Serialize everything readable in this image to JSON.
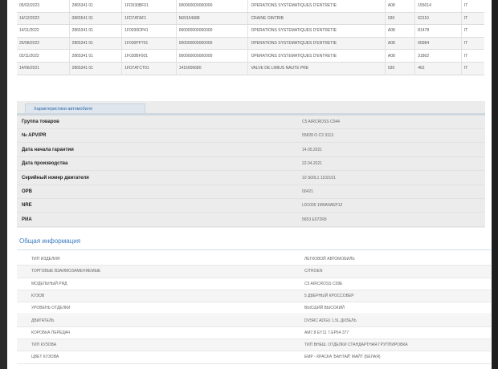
{
  "history": [
    [
      "05/02/2023",
      "2865341 01",
      "1FD030BF01",
      "000000000000000",
      "OPERATIONS SYSTEMATIQUES D'ENTRETIE",
      "A08",
      "155014",
      "IT"
    ],
    [
      "14/12/2022",
      "0865541 01",
      "1FD7ATAF1",
      "N09154688",
      "CRAINE OINTRIB",
      "030",
      "62110",
      "IT"
    ],
    [
      "14/11/2022",
      "2865341 01",
      "1F0030DP41",
      "000000000000000",
      "OPERATIONS SYSTEMATIQUES D'ENTRETIE",
      "A08",
      "81478",
      "IT"
    ],
    [
      "26/08/2022",
      "2865341 01",
      "1F030PP701",
      "000000000000000",
      "OPERATIONS SYSTEMATIQUES D'ENTRETIE",
      "A08",
      "66984",
      "IT"
    ],
    [
      "02/11/2022",
      "2865341 01",
      "1F030BF001",
      "000000000000000",
      "OPERATIONS SYSTEMATIQUES D'ENTRETIE",
      "A08",
      "31802",
      "IT"
    ],
    [
      "14/06/2021",
      "2865341 01",
      "1FD7ATCT01",
      "1415006680",
      "VALVE DE LIMIUS NAUTE PRE",
      "030",
      "462",
      "IT"
    ]
  ],
  "characteristics": {
    "tab_label": "Характеристики автомобиля",
    "rows": [
      {
        "label": "Группа товаров",
        "value": "C5 AIRCROSS C044"
      },
      {
        "label": "№ APV/PR",
        "value": "55828 O.C3 3113"
      },
      {
        "label": "Дата начала гарантии",
        "value": "14.05.2021"
      },
      {
        "label": "Дата производства",
        "value": "22.04.2021"
      },
      {
        "label": "Серийный номер двигателя",
        "value": "10 S00L1 1102101"
      },
      {
        "label": "OPB",
        "value": "00421"
      },
      {
        "label": "NRE",
        "value": "LD1005 1M9A9AEP12"
      },
      {
        "label": "PИA",
        "value": "5653 E072R9"
      }
    ]
  },
  "general": {
    "title": "Общая информация",
    "rows": [
      {
        "label": "ТИП ИЗДЕЛИЯ",
        "value": "ЛЕГКОВОЙ АВТОМОБИЛЬ"
      },
      {
        "label": "ТОРГОВЫЕ ВЗАИМОЗАМЕНЯЕМЫЕ",
        "value": "CITROEN"
      },
      {
        "label": "МОДЕЛЬНЫЙ РЯД",
        "value": "C5 AIRCROSS C09E"
      },
      {
        "label": "КУЗОВ",
        "value": "5 ДВЕРНЫЙ КРОССОВЕР"
      },
      {
        "label": "УРОВЕНЬ ОТДЕЛКИ",
        "value": "ВЫСШИЙ ВЫСОКИЙ"
      },
      {
        "label": "ДВИГАТЕЛЬ",
        "value": "DV5RC ADGU 1.5L ДИЗЕЛЬ"
      },
      {
        "label": "КОРОБКА ПЕРЕДАЧ",
        "value": "AM7.8 EY11 7.EP64 377"
      },
      {
        "label": "ТИП КУЗОВА",
        "value": "ТИП ВНЕШ. ОТДЕЛКИ СТАНДАРТНАЯ ГРУППИРОВКА"
      },
      {
        "label": "ЦВЕТ КУЗОВА",
        "value": "EMP - КРАСКА 'БАНТАЙ' МАЙТ (БЕЛАЯ)"
      }
    ]
  }
}
